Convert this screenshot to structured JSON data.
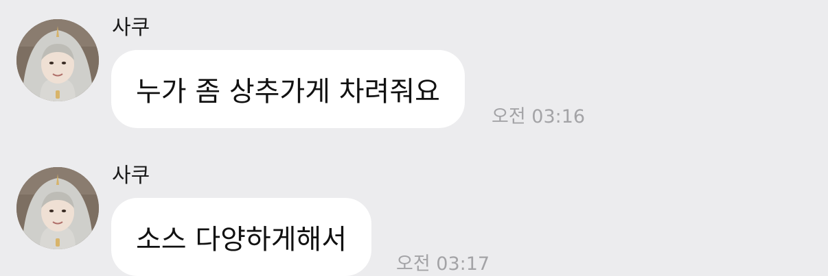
{
  "colors": {
    "background": "#ececee",
    "bubble": "#ffffff",
    "timestamp": "#a3a3a6"
  },
  "messages": [
    {
      "sender": "사쿠",
      "text": "누가 좀 상추가게 차려줘요",
      "time": "오전 03:16",
      "avatar_icon": "profile-photo-hooded-person"
    },
    {
      "sender": "사쿠",
      "text": "소스 다양하게해서",
      "time": "오전 03:17",
      "avatar_icon": "profile-photo-hooded-person"
    }
  ]
}
